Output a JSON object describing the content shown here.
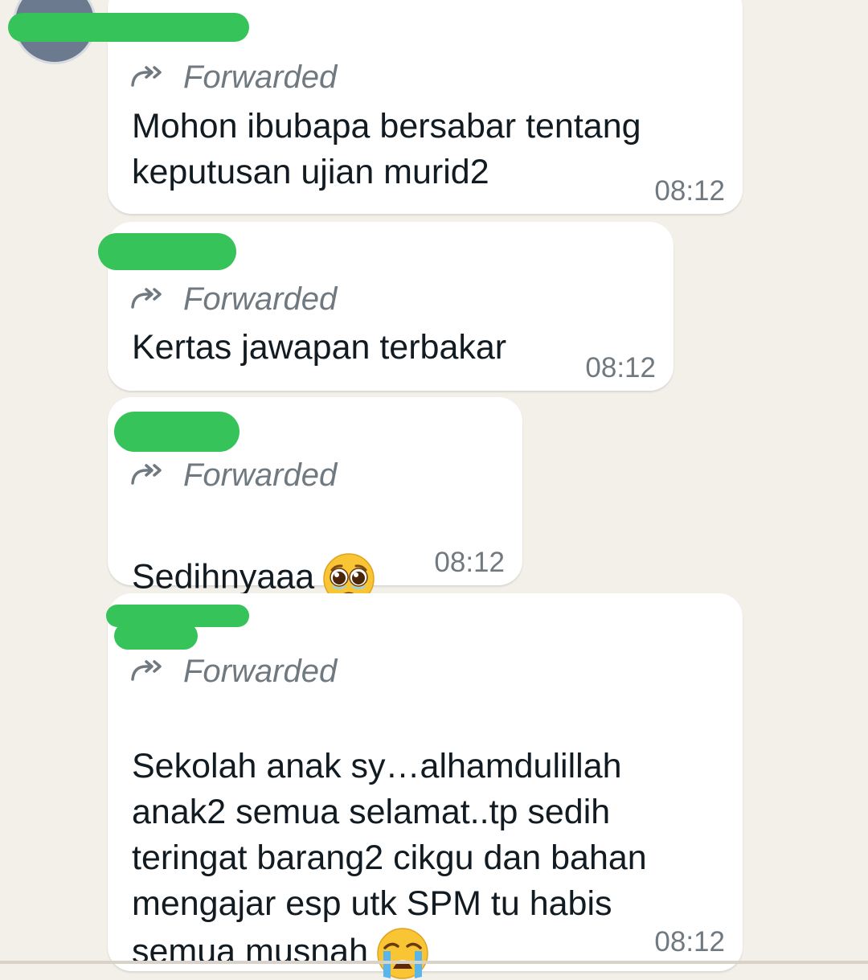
{
  "messages": [
    {
      "forwarded_label": "Forwarded",
      "text": "Mohon ibubapa bersabar tentang\nkeputusan ujian murid2",
      "time": "08:12"
    },
    {
      "forwarded_label": "Forwarded",
      "text": "Kertas jawapan terbakar",
      "time": "08:12"
    },
    {
      "forwarded_label": "Forwarded",
      "text": "Sedihnyaaa",
      "emoji": "pleading-face",
      "time": "08:12"
    },
    {
      "forwarded_label": "Forwarded",
      "text": "Sekolah anak sy…alhamdulillah\nanak2 semua selamat..tp sedih\nteringat barang2 cikgu dan bahan\nmengajar esp utk SPM tu habis\nsemua musnah",
      "emoji": "loudly-crying-face",
      "time": "08:12"
    }
  ],
  "colors": {
    "chat_background": "#f3f0ea",
    "bubble": "#ffffff",
    "redaction": "#35c35a",
    "meta_text": "#707980",
    "message_text": "#111b21"
  },
  "icons": {
    "forwarded": "forwarded-icon"
  }
}
